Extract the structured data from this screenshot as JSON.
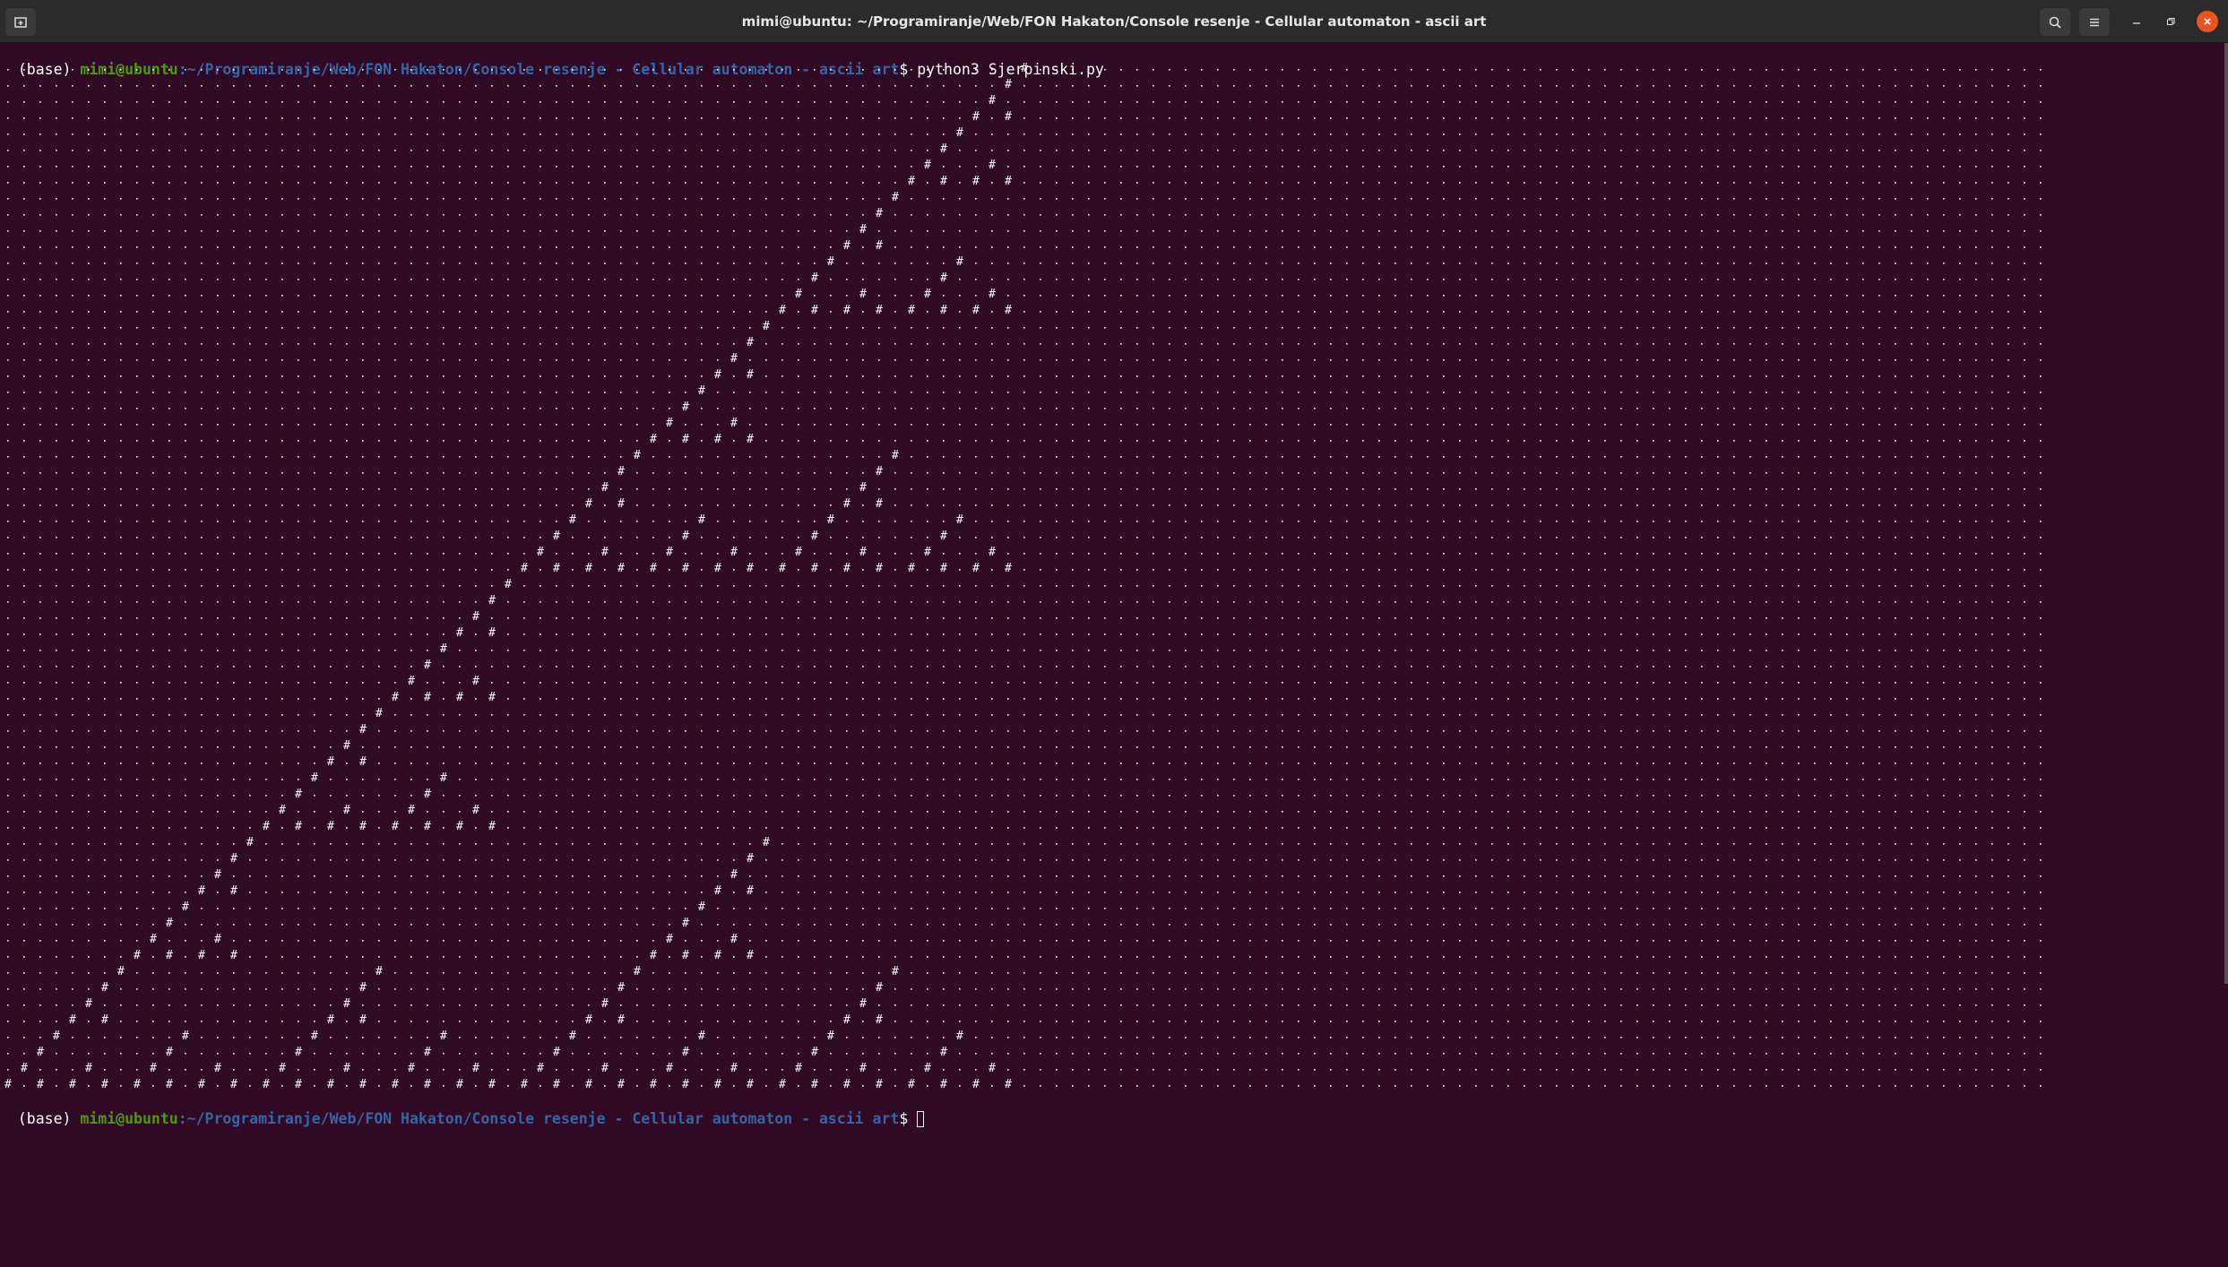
{
  "window": {
    "title": "mimi@ubuntu: ~/Programiranje/Web/FON Hakaton/Console resenje - Cellular automaton - ascii art",
    "icons": [
      "new-tab-icon",
      "search-icon",
      "hamburger-menu-icon",
      "minimize-icon",
      "maximize-icon",
      "close-icon"
    ]
  },
  "prompt1": {
    "prefix": "(base) ",
    "user": "mimi@ubuntu",
    "path": ":~/Programiranje/Web/FON Hakaton/Console resenje - Cellular automaton - ascii art",
    "symbol": "$ ",
    "command": "python3 Sjerpinski.py"
  },
  "prompt2": {
    "prefix": "(base) ",
    "user": "mimi@ubuntu",
    "path": ":~/Programiranje/Web/FON Hakaton/Console resenje - Cellular automaton - ascii art",
    "symbol": "$ ",
    "command": ""
  },
  "output": {
    "rows": 64,
    "columns": 127,
    "live_char": "#",
    "dead_char": ".",
    "rule": "Sierpinski (Pascal triangle mod 2)"
  },
  "colors": {
    "background": "#300a24",
    "foreground": "#ffffff",
    "prompt_user": "#4e9a06",
    "prompt_path": "#3465a4",
    "titlebar": "#2b2b2b",
    "close_button": "#e95420"
  }
}
